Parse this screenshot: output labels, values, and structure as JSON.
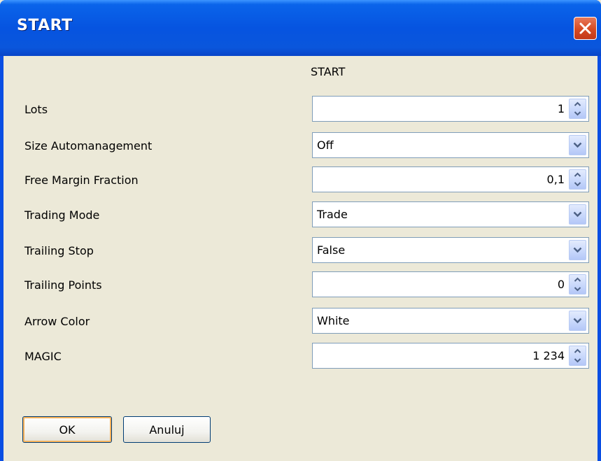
{
  "dialog": {
    "title": "START",
    "heading": "START"
  },
  "params": {
    "lots": {
      "label": "Lots",
      "value": "1"
    },
    "size_automanagement": {
      "label": "Size Automanagement",
      "value": "Off"
    },
    "free_margin_fraction": {
      "label": "Free Margin Fraction",
      "value": "0,1"
    },
    "trading_mode": {
      "label": "Trading Mode",
      "value": "Trade"
    },
    "trailing_stop": {
      "label": "Trailing Stop",
      "value": "False"
    },
    "trailing_points": {
      "label": "Trailing Points",
      "value": "0"
    },
    "arrow_color": {
      "label": "Arrow Color",
      "value": "White"
    },
    "magic": {
      "label": "MAGIC",
      "value": "1 234"
    }
  },
  "buttons": {
    "ok": "OK",
    "cancel": "Anuluj"
  },
  "icons": {
    "close": "close-icon",
    "dropdown": "chevron-down-icon",
    "spin_up": "spin-up-icon",
    "spin_down": "spin-down-icon"
  },
  "colors": {
    "titlebar": "#0654e0",
    "close_button": "#d74a22",
    "dialog_background": "#ece9d8",
    "field_border": "#7f9db9",
    "button_border": "#003c74"
  }
}
